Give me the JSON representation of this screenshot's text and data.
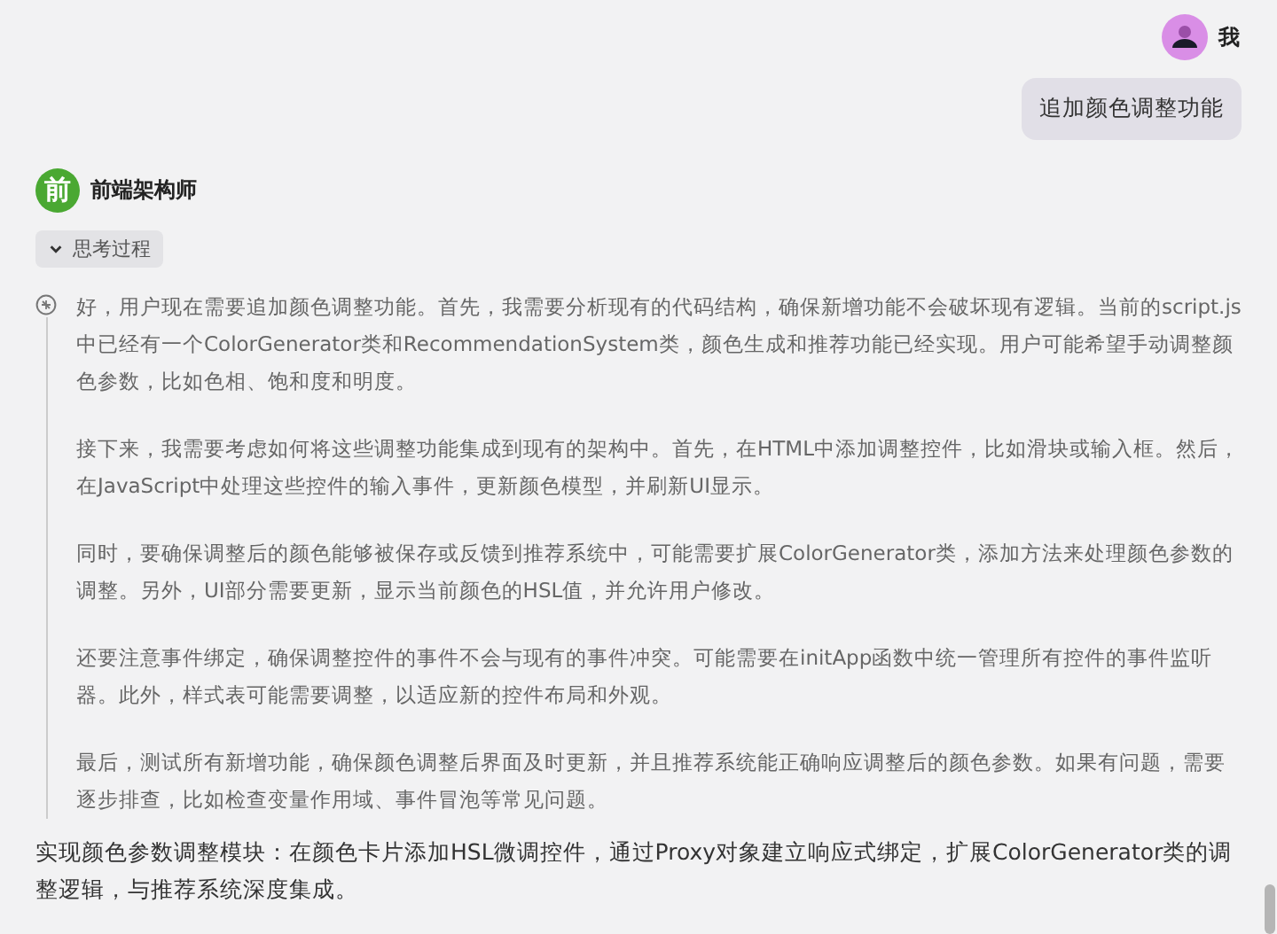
{
  "user": {
    "name": "我",
    "message": "追加颜色调整功能"
  },
  "assistant": {
    "avatar_letter": "前",
    "name": "前端架构师",
    "thinking_toggle": {
      "label": "思考过程",
      "expanded": true
    },
    "thinking": [
      "好，用户现在需要追加颜色调整功能。首先，我需要分析现有的代码结构，确保新增功能不会破坏现有逻辑。当前的script.js中已经有一个ColorGenerator类和RecommendationSystem类，颜色生成和推荐功能已经实现。用户可能希望手动调整颜色参数，比如色相、饱和度和明度。",
      "接下来，我需要考虑如何将这些调整功能集成到现有的架构中。首先，在HTML中添加调整控件，比如滑块或输入框。然后，在JavaScript中处理这些控件的输入事件，更新颜色模型，并刷新UI显示。",
      "同时，要确保调整后的颜色能够被保存或反馈到推荐系统中，可能需要扩展ColorGenerator类，添加方法来处理颜色参数的调整。另外，UI部分需要更新，显示当前颜色的HSL值，并允许用户修改。",
      "还要注意事件绑定，确保调整控件的事件不会与现有的事件冲突。可能需要在initApp函数中统一管理所有控件的事件监听器。此外，样式表可能需要调整，以适应新的控件布局和外观。",
      "最后，测试所有新增功能，确保颜色调整后界面及时更新，并且推荐系统能正确响应调整后的颜色参数。如果有问题，需要逐步排查，比如检查变量作用域、事件冒泡等常见问题。"
    ],
    "answer": "实现颜色参数调整模块：在颜色卡片添加HSL微调控件，通过Proxy对象建立响应式绑定，扩展ColorGenerator类的调整逻辑，与推荐系统深度集成。"
  }
}
